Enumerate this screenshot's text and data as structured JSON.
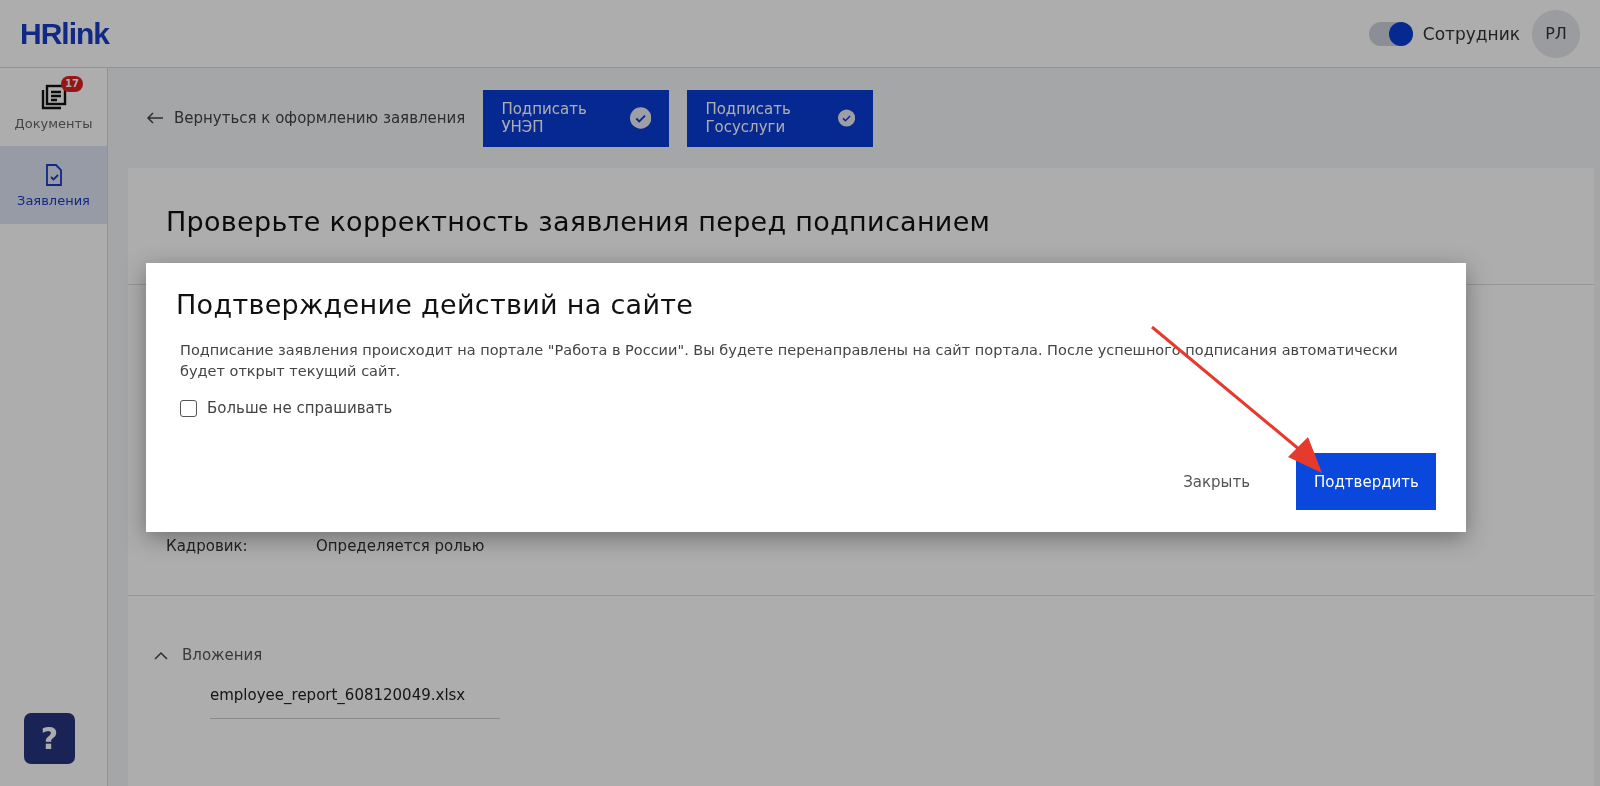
{
  "header": {
    "logo": "HRlink",
    "role_toggle": {
      "label": "Сотрудник",
      "on": true
    },
    "avatar": "РЛ"
  },
  "sidebar": {
    "items": [
      {
        "label": "Документы",
        "badge": "17",
        "selected": false,
        "kind": "documents"
      },
      {
        "label": "Заявления",
        "selected": true,
        "kind": "applications"
      }
    ],
    "help": "?"
  },
  "toolbar": {
    "back_link": "Вернуться к оформлению заявления",
    "buttons": [
      {
        "label": "Подписать УНЭП"
      },
      {
        "label": "Подписать Госуслуги"
      }
    ]
  },
  "card": {
    "title": "Проверьте корректность заявления перед подписанием",
    "fields": [
      {
        "label": "Кадровик:",
        "value": "Определяется ролью"
      }
    ],
    "attachments": {
      "title": "Вложения",
      "expanded": true,
      "files": [
        "employee_report_608120049.xlsx"
      ]
    }
  },
  "dialog": {
    "title": "Подтверждение действий на сайте",
    "text": "Подписание заявления происходит на портале \"Работа в России\". Вы будете перенаправлены на сайт портала. После успешного подписания автоматически будет открыт текущий сайт.",
    "checkbox": {
      "label": "Больше не спрашивать",
      "checked": false
    },
    "buttons": [
      {
        "label": "Закрыть",
        "kind": "secondary"
      },
      {
        "label": "Подтвердить",
        "kind": "primary"
      }
    ]
  }
}
